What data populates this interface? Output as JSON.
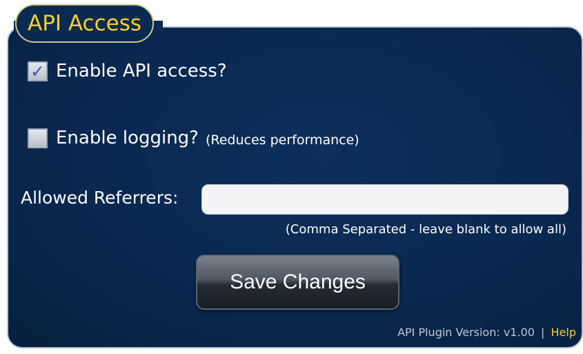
{
  "panel": {
    "title": "API Access"
  },
  "options": {
    "api_access_label": "Enable API access?",
    "api_access_checked": true,
    "logging_label": "Enable logging?",
    "logging_note": "(Reduces performance)",
    "logging_checked": false
  },
  "referrers": {
    "label": "Allowed Referrers:",
    "value": "",
    "placeholder": "",
    "hint": "(Comma Separated - leave blank to allow all)"
  },
  "actions": {
    "save_label": "Save Changes"
  },
  "footer": {
    "version_text": "API Plugin Version: v1.00",
    "separator": "|",
    "help_label": "Help"
  },
  "colors": {
    "accent": "#f4d12a",
    "panel_background": "#0a2850",
    "text": "#ffffff"
  },
  "icons": {
    "checkmark": "checkmark-icon"
  }
}
